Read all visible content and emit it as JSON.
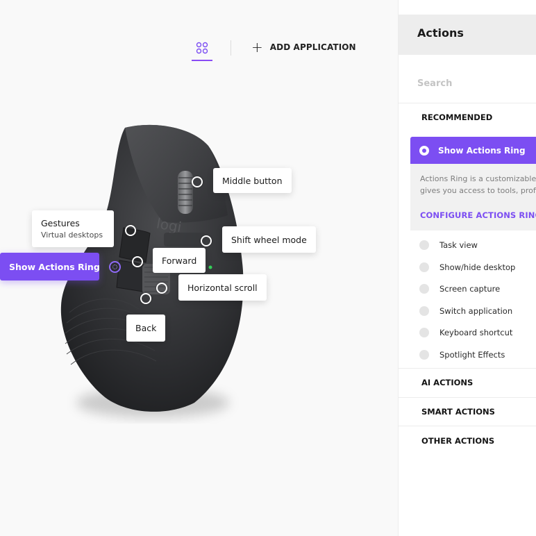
{
  "toolbar": {
    "grid_icon": "grid-icon",
    "add_application_label": "ADD APPLICATION",
    "plus_icon": "plus-icon"
  },
  "mouse": {
    "logo_text": "logi",
    "callouts": {
      "middle_button": "Middle button",
      "gestures": "Gestures",
      "gestures_sub": "Virtual desktops",
      "shift_wheel_mode": "Shift wheel mode",
      "show_actions_ring": "Show Actions Ring",
      "forward": "Forward",
      "horizontal_scroll": "Horizontal scroll",
      "back": "Back"
    }
  },
  "panel": {
    "title": "Actions",
    "search_placeholder": "Search",
    "recommended": "RECOMMENDED",
    "selected_action": "Show Actions Ring",
    "description_line1": "Actions Ring is a customizable overlay that",
    "description_line2": "gives you access to tools, profiles and more",
    "configure_label": "CONFIGURE ACTIONS RING",
    "options": [
      "Task view",
      "Show/hide desktop",
      "Screen capture",
      "Switch application",
      "Keyboard shortcut",
      "Spotlight Effects"
    ],
    "sections": {
      "ai_actions": "AI ACTIONS",
      "smart_actions": "SMART ACTIONS",
      "other_actions": "OTHER ACTIONS"
    }
  },
  "colors": {
    "accent": "#7c4ef2",
    "background": "#f9f9f9",
    "panel_header": "#ededed"
  }
}
